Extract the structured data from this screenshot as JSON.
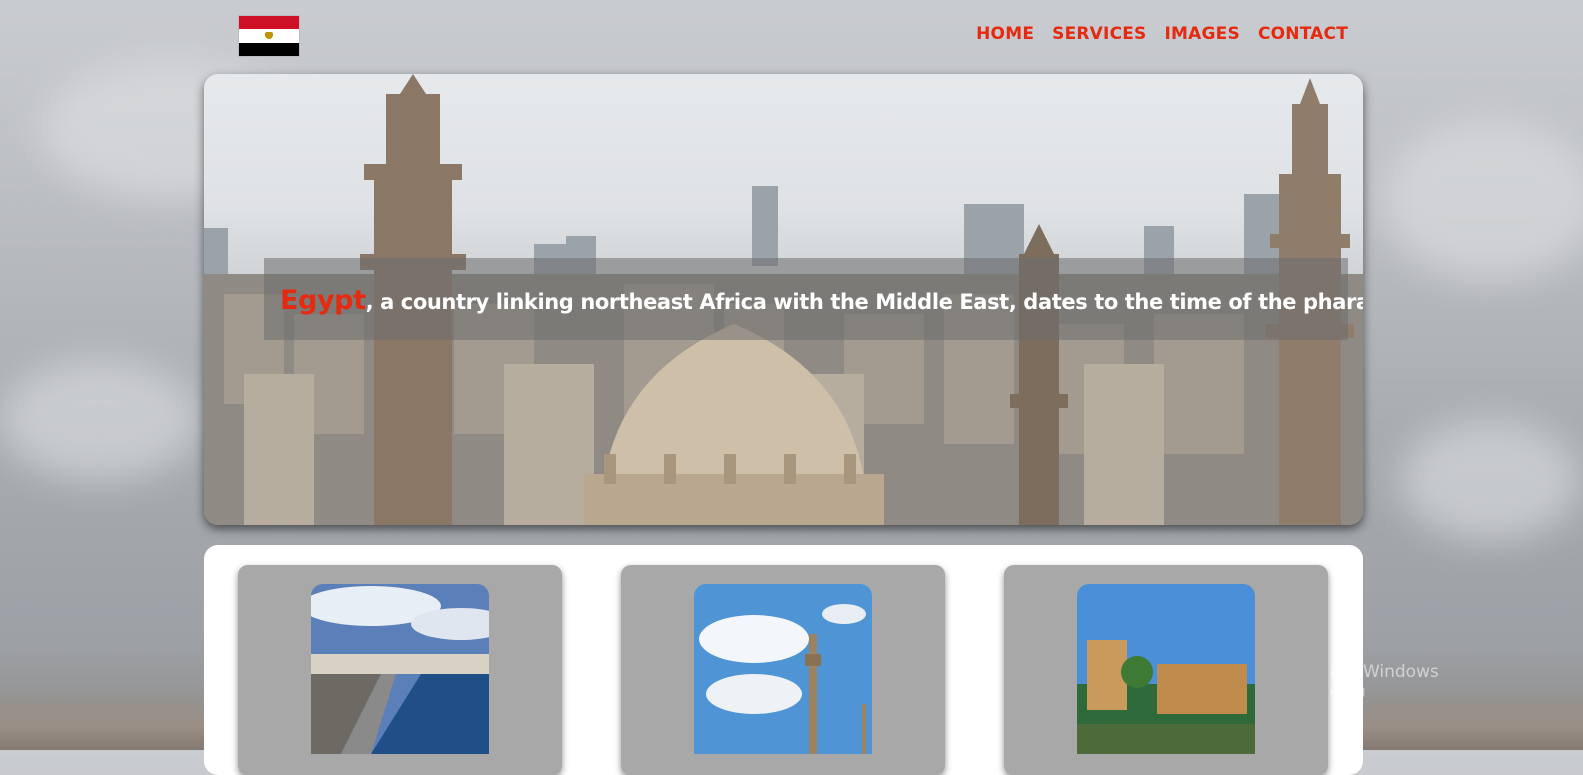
{
  "header": {
    "flag_alt": "Egypt flag",
    "nav": [
      {
        "label": "HOME"
      },
      {
        "label": "SERVICES"
      },
      {
        "label": "IMAGES"
      },
      {
        "label": "CONTACT"
      }
    ]
  },
  "hero": {
    "highlight": "Egypt",
    "tagline": ", a country linking northeast Africa with the Middle East, dates to the time of the pharaohs."
  },
  "cards": [
    {
      "image": "alexandria-corniche"
    },
    {
      "image": "cairo-tower"
    },
    {
      "image": "philae-temple"
    }
  ],
  "overlay": {
    "watermark_line1": "ate Windows",
    "watermark_line2": "etting"
  },
  "colors": {
    "accent": "#e62a10",
    "card": "#a8a8a8",
    "panel": "#ffffff"
  }
}
